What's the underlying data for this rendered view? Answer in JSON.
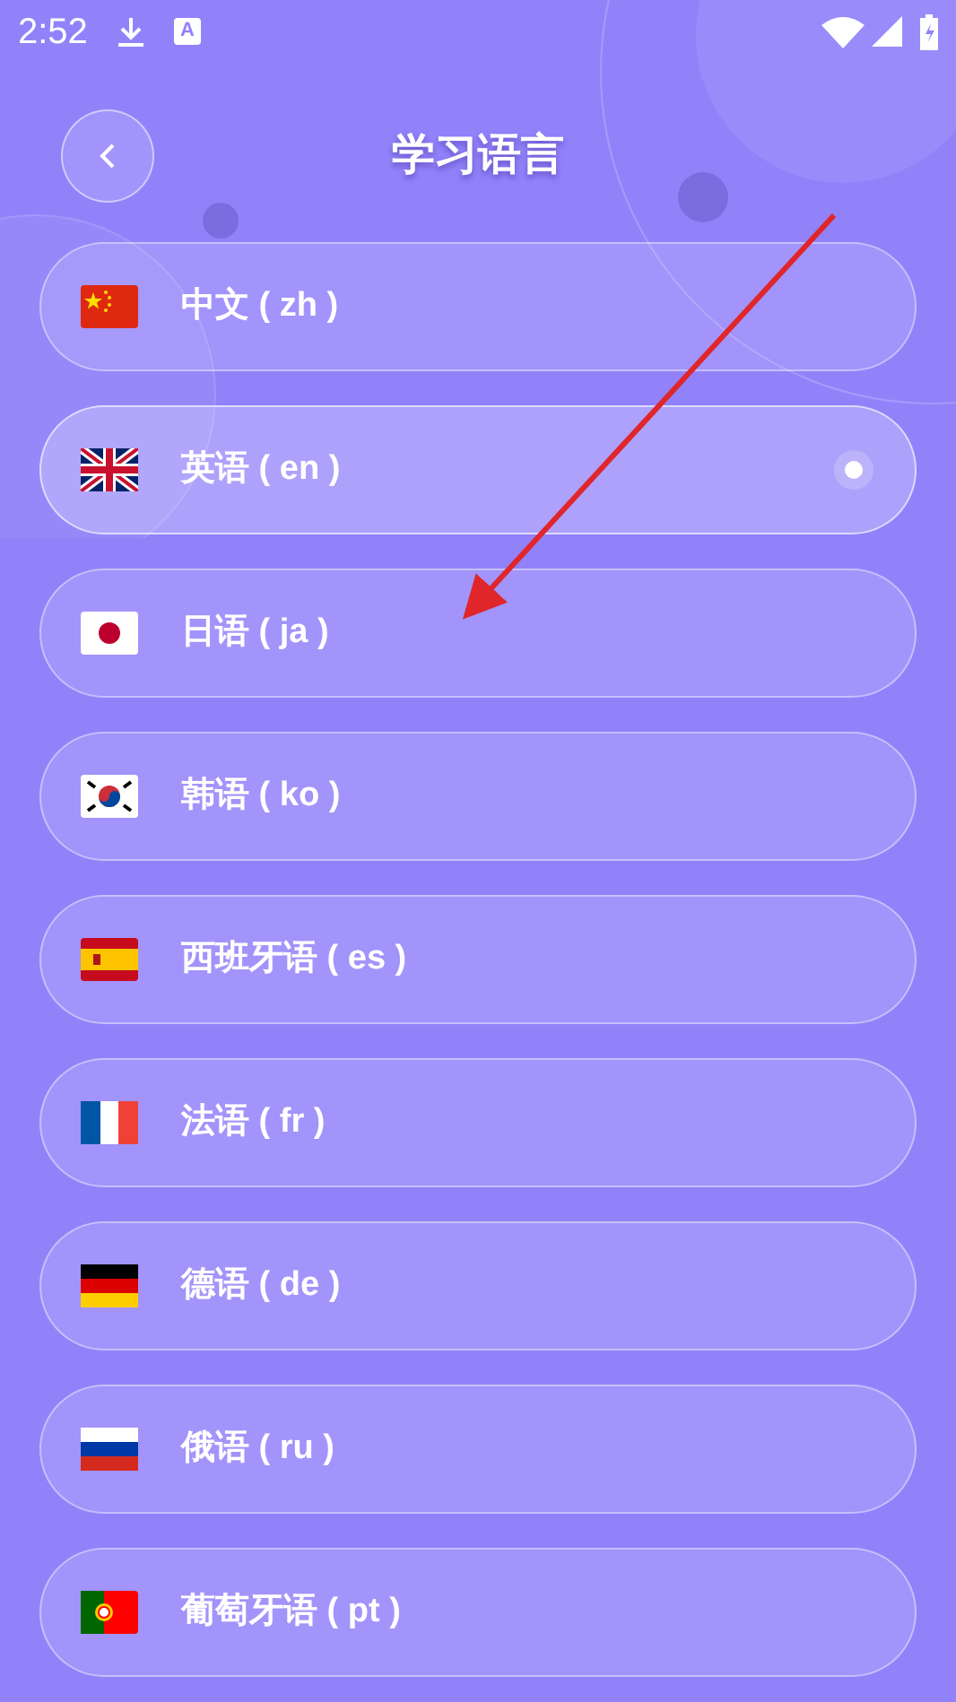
{
  "status_bar": {
    "time": "2:52",
    "notification_letter": "A"
  },
  "header": {
    "title": "学习语言"
  },
  "languages": [
    {
      "label": "中文 ( zh )",
      "selected": false
    },
    {
      "label": "英语 ( en )",
      "selected": true
    },
    {
      "label": "日语 ( ja )",
      "selected": false
    },
    {
      "label": "韩语 ( ko )",
      "selected": false
    },
    {
      "label": "西班牙语 ( es )",
      "selected": false
    },
    {
      "label": "法语 ( fr )",
      "selected": false
    },
    {
      "label": "德语 ( de )",
      "selected": false
    },
    {
      "label": "俄语 ( ru )",
      "selected": false
    },
    {
      "label": "葡萄牙语 ( pt )",
      "selected": false
    }
  ]
}
